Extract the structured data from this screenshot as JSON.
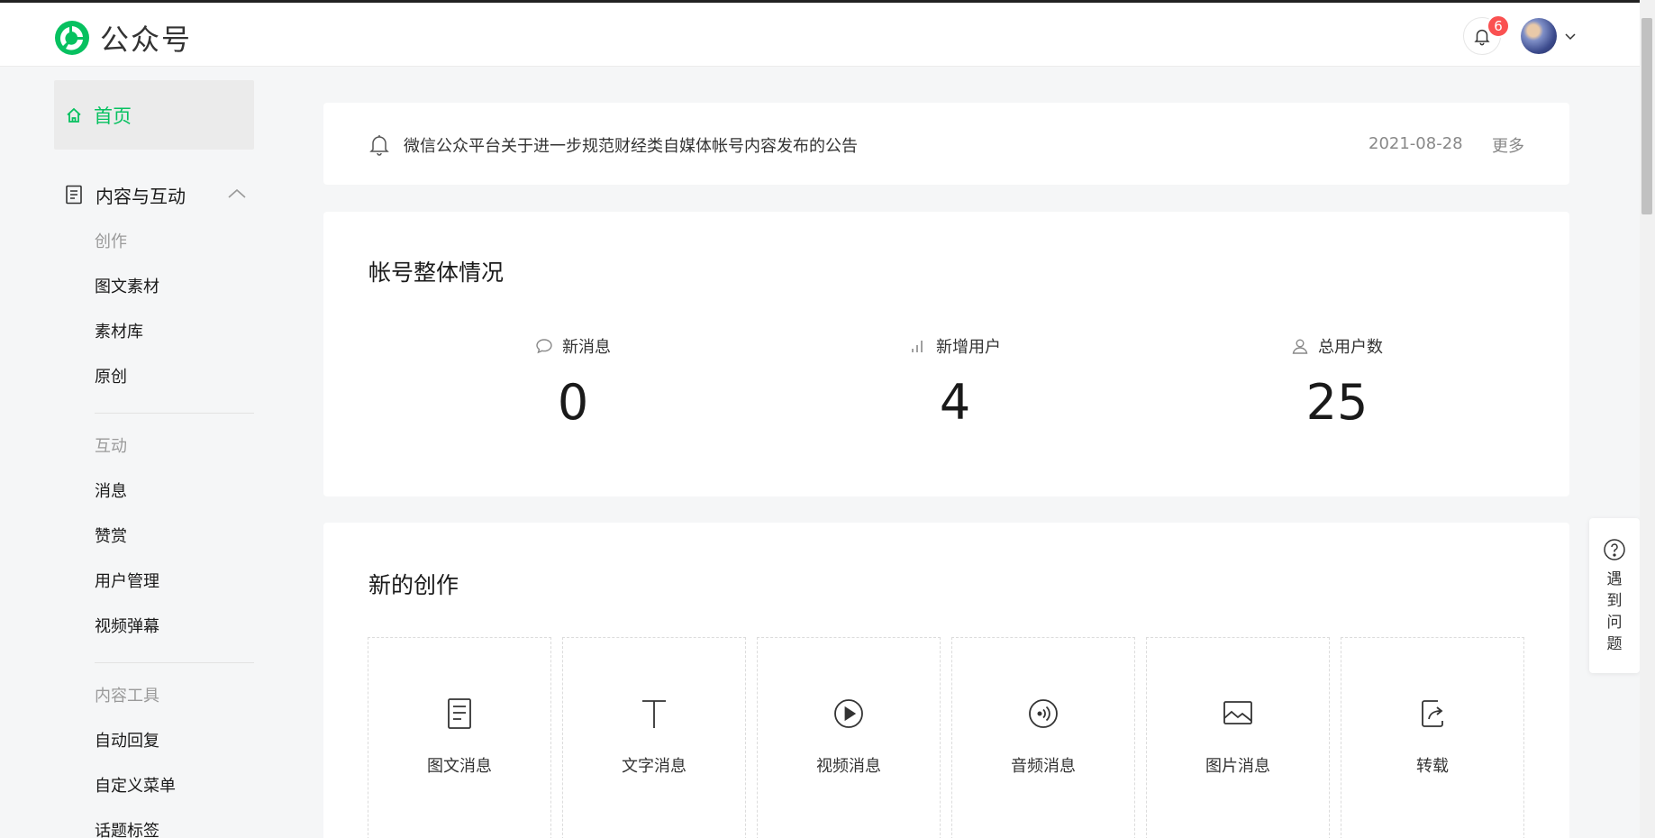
{
  "header": {
    "logo_text": "公众号",
    "notification_count": "6"
  },
  "sidebar": {
    "home_label": "首页",
    "group_label": "内容与互动",
    "sections": [
      {
        "heading": "创作",
        "items": [
          "图文素材",
          "素材库",
          "原创"
        ]
      },
      {
        "heading": "互动",
        "items": [
          "消息",
          "赞赏",
          "用户管理",
          "视频弹幕"
        ]
      },
      {
        "heading": "内容工具",
        "items": [
          "自动回复",
          "自定义菜单",
          "话题标签"
        ]
      }
    ]
  },
  "notice": {
    "text": "微信公众平台关于进一步规范财经类自媒体帐号内容发布的公告",
    "date": "2021-08-28",
    "more_label": "更多"
  },
  "overview": {
    "title": "帐号整体情况",
    "stats": [
      {
        "label": "新消息",
        "value": "0",
        "icon": "chat-bubble-icon"
      },
      {
        "label": "新增用户",
        "value": "4",
        "icon": "bar-chart-icon"
      },
      {
        "label": "总用户数",
        "value": "25",
        "icon": "user-icon"
      }
    ]
  },
  "create": {
    "title": "新的创作",
    "tiles": [
      {
        "label": "图文消息",
        "icon": "document-icon"
      },
      {
        "label": "文字消息",
        "icon": "text-icon"
      },
      {
        "label": "视频消息",
        "icon": "play-icon"
      },
      {
        "label": "音频消息",
        "icon": "audio-icon"
      },
      {
        "label": "图片消息",
        "icon": "image-icon"
      },
      {
        "label": "转载",
        "icon": "repost-icon"
      }
    ]
  },
  "help": {
    "label": "遇到问题"
  },
  "colors": {
    "accent": "#07c160",
    "badge": "#fa5151"
  }
}
